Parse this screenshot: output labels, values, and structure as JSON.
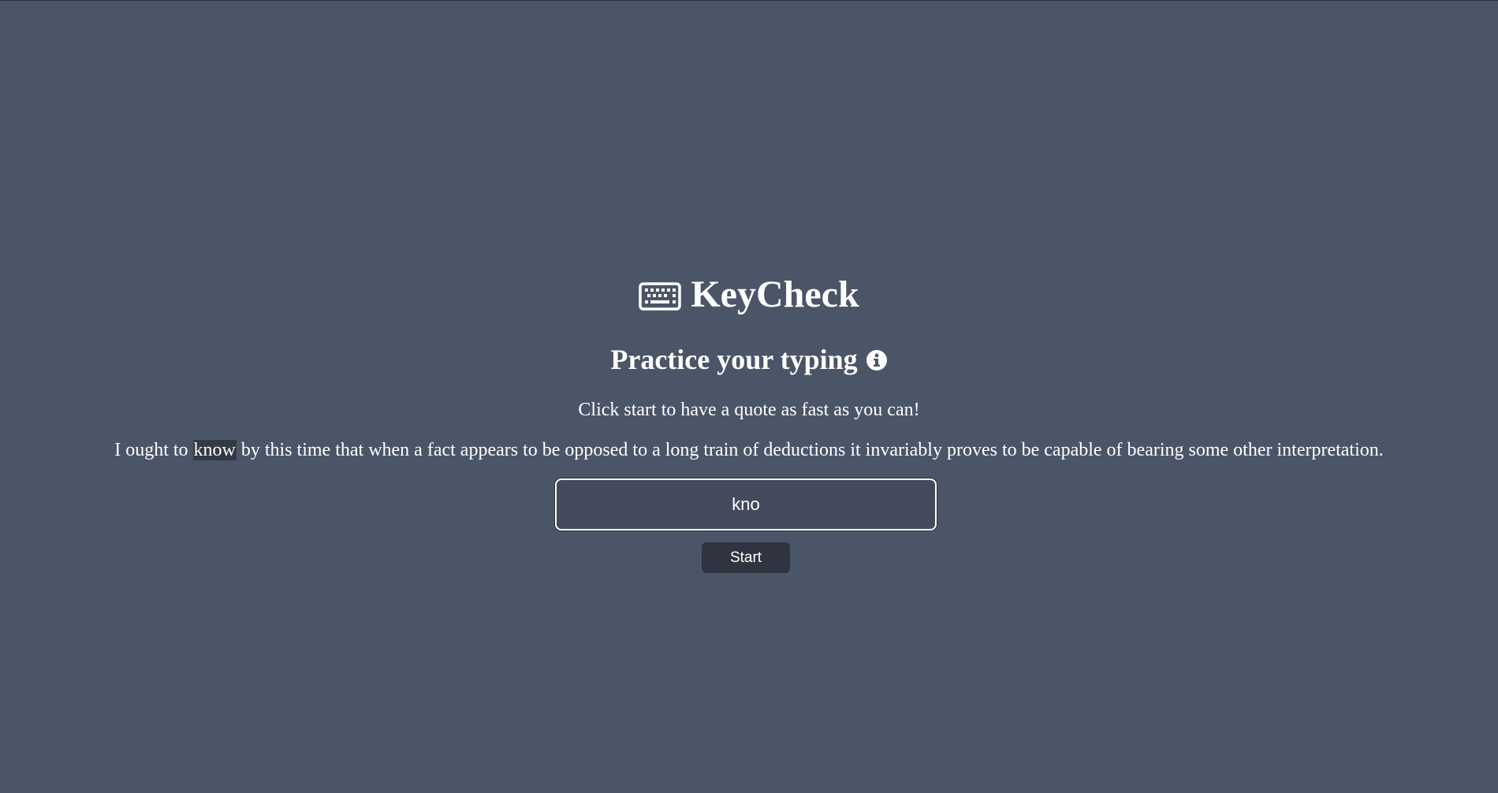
{
  "header": {
    "app_title": "KeyCheck",
    "logo_icon": "keyboard-icon"
  },
  "intro": {
    "subtitle": "Practice your typing",
    "info_icon": "info-circle-icon",
    "instructions": "Click start to have a quote as fast as you can!"
  },
  "quote": {
    "before": "I ought to ",
    "current_word": "know",
    "after": " by this time that when a fact appears to be opposed to a long train of deductions it invariably proves to be capable of bearing some other interpretation."
  },
  "typing": {
    "value": "kno"
  },
  "controls": {
    "start_label": "Start"
  },
  "colors": {
    "background": "#4b5568",
    "input_background": "#434b5c",
    "button_background": "#2f3440",
    "highlight": "#333a45",
    "text": "#ffffff"
  }
}
